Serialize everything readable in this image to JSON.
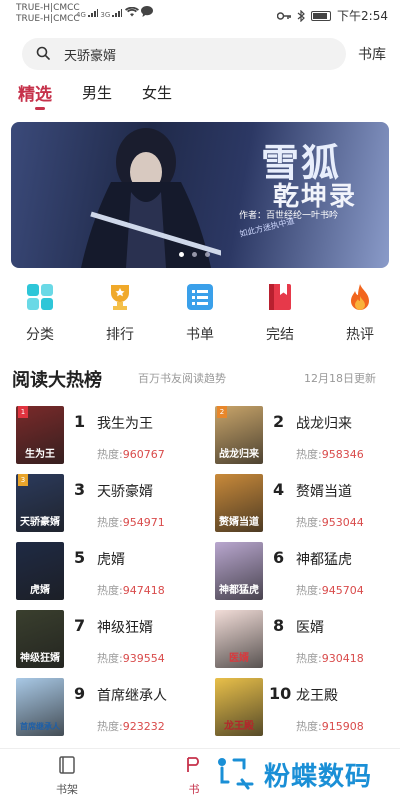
{
  "status": {
    "carrier1": "TRUE-H|CMCC",
    "carrier2": "TRUE-H|CMCC",
    "net1": "4G",
    "net2": "3G",
    "time": "下午2:54"
  },
  "search": {
    "placeholder": "天骄豪婿"
  },
  "header": {
    "shelf_label": "书库"
  },
  "tabs": [
    {
      "label": "精选",
      "active": true
    },
    {
      "label": "男生",
      "active": false
    },
    {
      "label": "女生",
      "active": false
    }
  ],
  "banner": {
    "title_line1": "雪狐",
    "title_line2": "乾坤录",
    "author": "作者：百世经纶一叶书吟",
    "subtitle": "如此方迷执中道",
    "slides": 3,
    "active_slide": 1
  },
  "categories": [
    {
      "label": "分类",
      "icon": "grid-icon",
      "color": "#2ec6d8"
    },
    {
      "label": "排行",
      "icon": "trophy-icon",
      "color": "#f0a92a"
    },
    {
      "label": "书单",
      "icon": "list-icon",
      "color": "#3aa0ea"
    },
    {
      "label": "完结",
      "icon": "bookmark-book-icon",
      "color": "#e6394a"
    },
    {
      "label": "热评",
      "icon": "flame-icon",
      "color": "#f2661e"
    }
  ],
  "ranking": {
    "title": "阅读大热榜",
    "subtitle": "百万书友阅读趋势",
    "date": "12月18日更新",
    "heat_label": "热度:",
    "books": [
      {
        "rank": "1",
        "name": "我生为王",
        "heat": "960767",
        "cover_text": "生为王",
        "cover_color": "#7a2a2a"
      },
      {
        "rank": "2",
        "name": "战龙归来",
        "heat": "958346",
        "cover_text": "战龙归来",
        "cover_color": "#c9a56a"
      },
      {
        "rank": "3",
        "name": "天骄豪婿",
        "heat": "954971",
        "cover_text": "天骄豪婿",
        "cover_color": "#2b3a5c"
      },
      {
        "rank": "4",
        "name": "赘婿当道",
        "heat": "953044",
        "cover_text": "赘婿当道",
        "cover_color": "#c98a3a"
      },
      {
        "rank": "5",
        "name": "虎婿",
        "heat": "947418",
        "cover_text": "虎婿",
        "cover_color": "#1f2a44"
      },
      {
        "rank": "6",
        "name": "神都猛虎",
        "heat": "945704",
        "cover_text": "神都猛虎",
        "cover_color": "#b9a7cf"
      },
      {
        "rank": "7",
        "name": "神级狂婿",
        "heat": "939554",
        "cover_text": "神级狂婿",
        "cover_color": "#3a3f2e"
      },
      {
        "rank": "8",
        "name": "医婿",
        "heat": "930418",
        "cover_text": "医婿",
        "cover_color": "#f2ddd8"
      },
      {
        "rank": "9",
        "name": "首席继承人",
        "heat": "923232",
        "cover_text": "首席继承人",
        "cover_color": "#a9c9e6"
      },
      {
        "rank": "10",
        "name": "龙王殿",
        "heat": "915908",
        "cover_text": "龙王殿",
        "cover_color": "#e9c04a"
      }
    ]
  },
  "bottom_nav": [
    {
      "label": "书架",
      "icon": "book-icon"
    },
    {
      "label": "书",
      "icon": "store-icon"
    }
  ],
  "watermark": {
    "text": "粉蝶数码"
  }
}
